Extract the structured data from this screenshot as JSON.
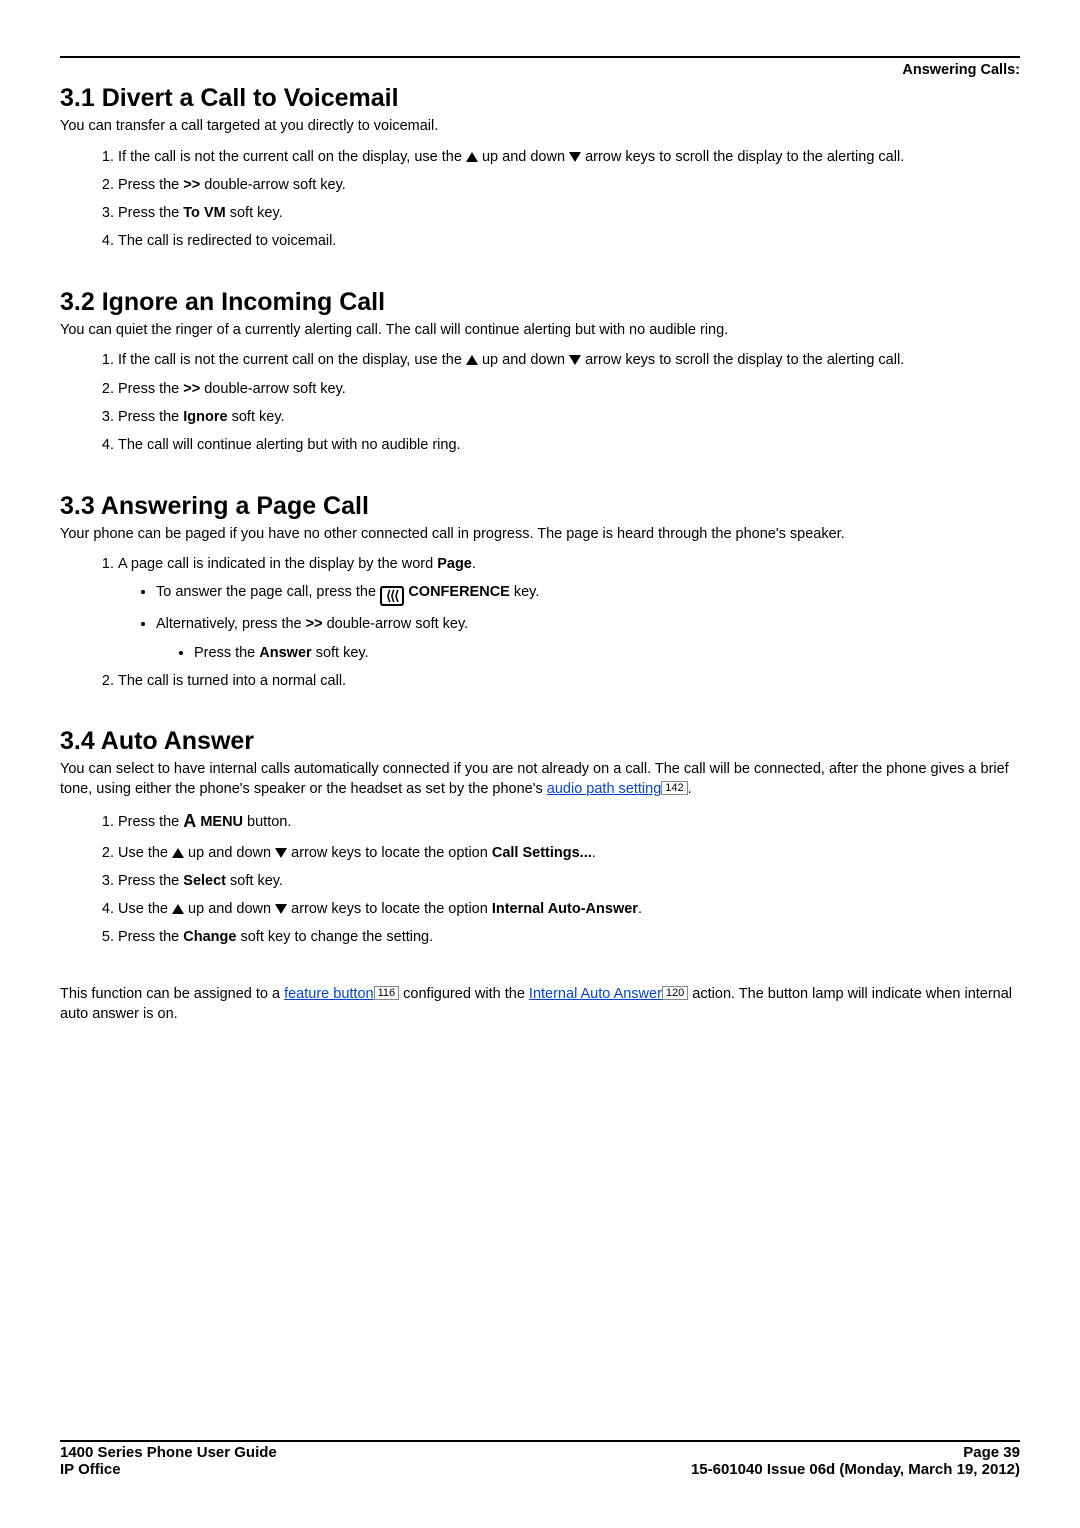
{
  "header": {
    "category": "Answering Calls:"
  },
  "s1": {
    "title": "3.1 Divert a Call to Voicemail",
    "intro": "You can transfer a call targeted at you directly to voicemail.",
    "step1a": "If the call is not the current call on the display, use the ",
    "step1b": " up and down ",
    "step1c": " arrow keys to scroll the display to the alerting call.",
    "step2a": "Press the ",
    "step2b": ">>",
    "step2c": " double-arrow soft key.",
    "step3a": "Press the ",
    "step3b": "To VM",
    "step3c": " soft key.",
    "step4": "The call is redirected to voicemail."
  },
  "s2": {
    "title": "3.2 Ignore an Incoming Call",
    "intro": "You can quiet the ringer of a currently alerting call. The call will continue alerting but with no audible ring.",
    "step1a": "If the call is not the current call on the display, use the ",
    "step1b": " up and down ",
    "step1c": " arrow keys to scroll the display to the alerting call.",
    "step2a": "Press the ",
    "step2b": ">>",
    "step2c": " double-arrow soft key.",
    "step3a": "Press the ",
    "step3b": "Ignore",
    "step3c": " soft key.",
    "step4": "The call will continue alerting but with no audible ring."
  },
  "s3": {
    "title": "3.3 Answering a Page Call",
    "intro": "Your phone can be paged if you have no other connected call in progress. The page is heard through the phone's speaker.",
    "step1a": "A page call is indicated in the display by the word ",
    "step1b": "Page",
    "step1c": ".",
    "b1a": "To answer the page call, press the ",
    "b1_icon": "⦀⦀⦀",
    "b1b": " CONFERENCE",
    "b1c": " key.",
    "b2a": "Alternatively, press the ",
    "b2b": ">>",
    "b2c": " double-arrow soft key.",
    "b2aa": "Press the ",
    "b2ab": "Answer",
    "b2ac": " soft key.",
    "step2": "The call is turned into a normal call."
  },
  "s4": {
    "title": "3.4 Auto Answer",
    "intro_a": "You can select to have internal calls automatically connected if you are not already on a call. The call will be connected, after the phone gives a brief tone, using either the phone's speaker or the headset as set by the phone's ",
    "intro_link": "audio path setting",
    "intro_ref": "142",
    "intro_b": ".",
    "step1a": "Press the ",
    "step1_icon": "A",
    "step1b": " MENU",
    "step1c": " button.",
    "step2a": "Use the ",
    "step2b": " up and down ",
    "step2c": " arrow keys to locate the option ",
    "step2d": "Call Settings...",
    "step2e": ".",
    "step3a": "Press the ",
    "step3b": "Select",
    "step3c": " soft key.",
    "step4a": "Use the ",
    "step4b": " up and down ",
    "step4c": " arrow keys to locate the option ",
    "step4d": "Internal Auto-Answer",
    "step4e": ".",
    "step5a": "Press the ",
    "step5b": "Change",
    "step5c": " soft key to change the setting.",
    "note_a": "This function can be assigned to a ",
    "note_link1": "feature button",
    "note_ref1": "116",
    "note_b": " configured with the ",
    "note_link2": "Internal Auto Answer",
    "note_ref2": "120",
    "note_c": " action. The button lamp will indicate when internal auto answer is on."
  },
  "footer": {
    "left1": "1400 Series Phone User Guide",
    "right1": "Page 39",
    "left2": "IP Office",
    "right2": "15-601040 Issue 06d (Monday, March 19, 2012)"
  }
}
